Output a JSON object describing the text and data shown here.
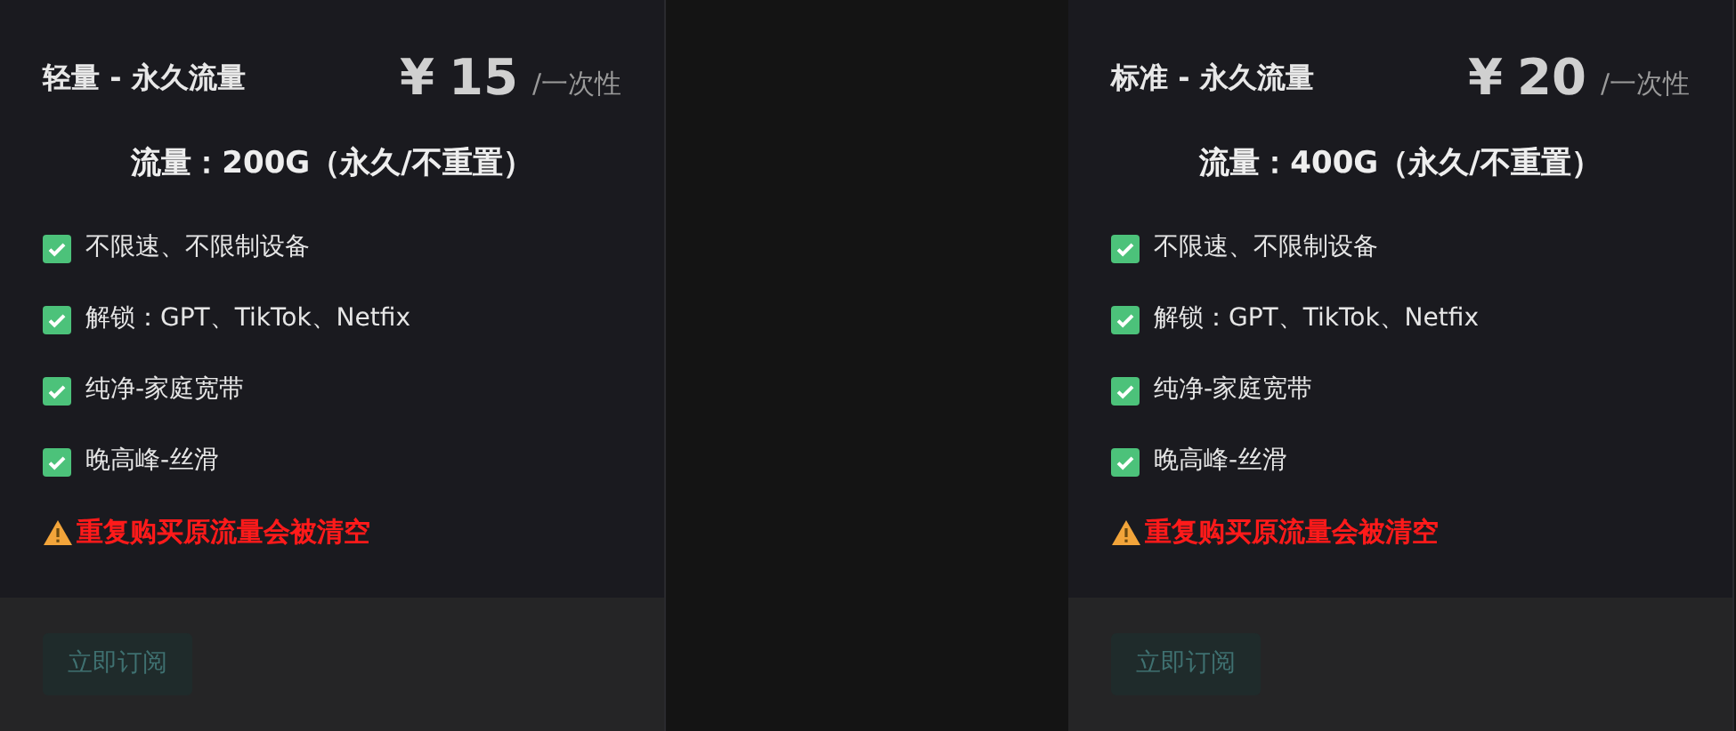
{
  "plans": [
    {
      "name": "轻量 - 永久流量",
      "currency": "¥",
      "price": "15",
      "period": "/一次性",
      "headline": "流量：200G（永久/不重置）",
      "features": [
        "不限速、不限制设备",
        "解锁：GPT、TikTok、Netfix",
        "纯净-家庭宽带",
        "晚高峰-丝滑"
      ],
      "warning": "重复购买原流量会被清空",
      "button": {
        "label": "立即订阅",
        "disabled": true
      }
    },
    {
      "name": "标准 - 永久流量",
      "currency": "¥",
      "price": "20",
      "period": "/一次性",
      "headline": "流量：400G（永久/不重置）",
      "features": [
        "不限速、不限制设备",
        "解锁：GPT、TikTok、Netfix",
        "纯净-家庭宽带",
        "晚高峰-丝滑"
      ],
      "warning": "重复购买原流量会被清空",
      "button": {
        "label": "立即订阅",
        "disabled": true
      }
    }
  ]
}
